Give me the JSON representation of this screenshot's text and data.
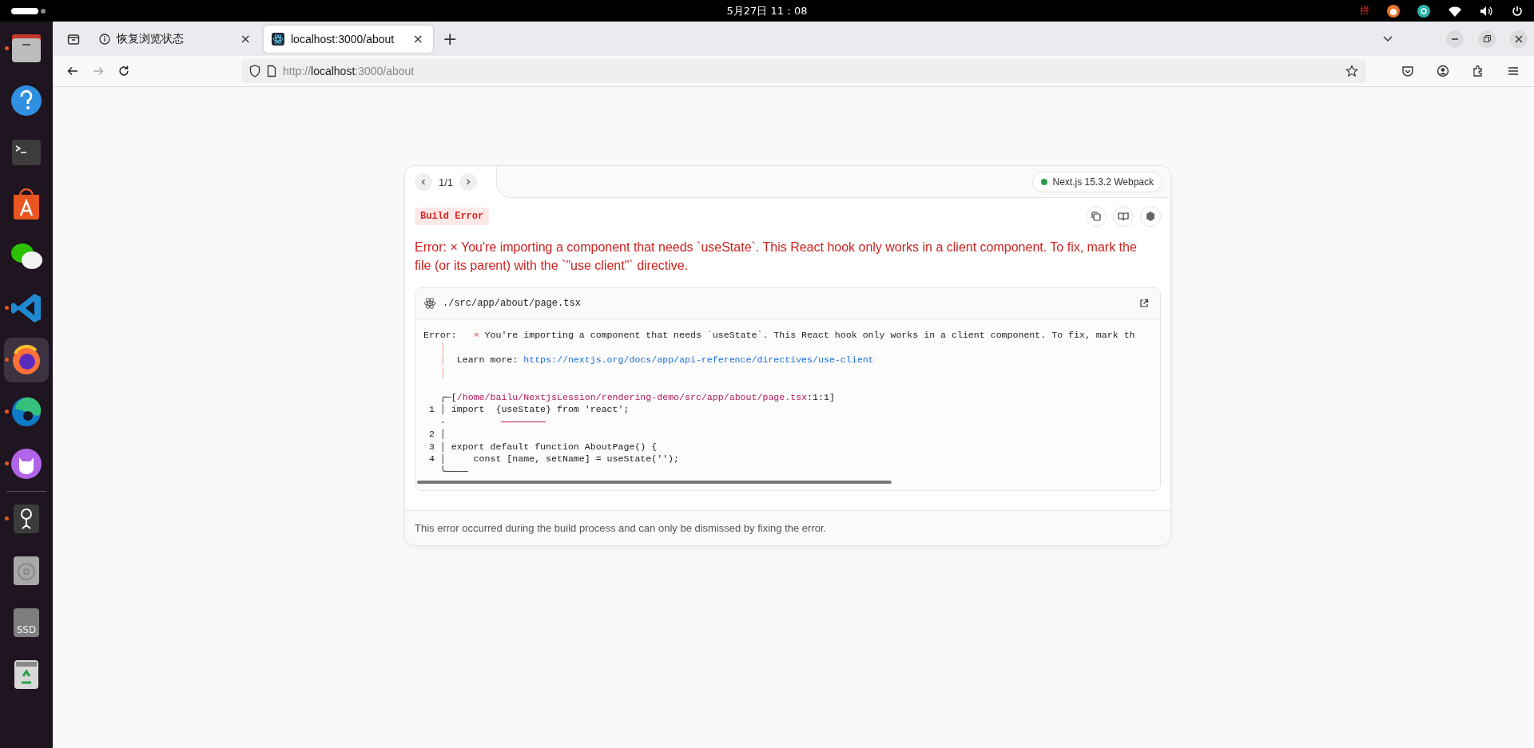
{
  "top_bar": {
    "clock": "5月27日  11：08",
    "input_method": "拼"
  },
  "dock": [
    {
      "kind": "files",
      "running": true,
      "selected": false
    },
    {
      "kind": "help",
      "running": false,
      "selected": false
    },
    {
      "kind": "terminal",
      "running": false,
      "selected": false
    },
    {
      "kind": "store",
      "running": false,
      "selected": false
    },
    {
      "kind": "chat",
      "running": false,
      "selected": false
    },
    {
      "kind": "code",
      "running": true,
      "selected": false
    },
    {
      "kind": "firefox",
      "running": true,
      "selected": true
    },
    {
      "kind": "edge",
      "running": true,
      "selected": false
    },
    {
      "kind": "cat",
      "running": true,
      "selected": false
    },
    {
      "kind": "separator"
    },
    {
      "kind": "webcam",
      "running": true,
      "selected": false
    },
    {
      "kind": "disc",
      "running": false,
      "selected": false
    },
    {
      "kind": "ssd",
      "label": "SSD",
      "running": false,
      "selected": false
    },
    {
      "kind": "trash",
      "running": false,
      "selected": false
    }
  ],
  "tabs": [
    {
      "kind": "notice",
      "label": "恢复浏览状态",
      "close": "×",
      "selected": false
    },
    {
      "kind": "site",
      "label": "localhost:3000/about",
      "close": "×",
      "selected": true
    }
  ],
  "new_tab": "+",
  "address_bar": {
    "scheme": "http://",
    "host": "localhost",
    "rest": ":3000/about"
  },
  "nav": {
    "back_disabled": false,
    "forward_disabled": true
  },
  "error_overlay": {
    "pager": "1/1",
    "prev_disabled": false,
    "next_disabled": false,
    "badge": {
      "label": "Next.js 15.3.2 Webpack",
      "color": "#2a9d4a"
    },
    "label": "Build Error",
    "message": "Error:  × You're importing a component that needs `useState`. This React hook only works in a client component. To fix, mark the file (or its parent) with the `\"use client\"` directive.",
    "file": "./src/app/about/page.tsx",
    "code_lines": [
      {
        "kind": "message",
        "segments": [
          {
            "kind": "plain",
            "text": "Error:   "
          },
          {
            "kind": "error",
            "text": "×"
          },
          {
            "kind": "plain",
            "text": " You're importing a component that needs `useState`. This React hook only works in a client component. To fix, mark th"
          }
        ]
      },
      {
        "kind": "note",
        "segments": [
          {
            "kind": "pipe",
            "text": "│"
          }
        ]
      },
      {
        "kind": "note",
        "segments": [
          {
            "kind": "pipe",
            "text": "│"
          },
          {
            "kind": "plain",
            "text": "  Learn more: "
          },
          {
            "kind": "link",
            "text": "https://nextjs.org/docs/app/api-reference/directives/use-client"
          }
        ]
      },
      {
        "kind": "note",
        "segments": [
          {
            "kind": "pipe",
            "text": "│"
          }
        ]
      },
      {
        "kind": "frame",
        "segments": [
          {
            "kind": "plain",
            "text": "   ╭─["
          },
          {
            "kind": "path",
            "text": "/home/bailu/NextjsLession/rendering-demo/src/app/about/page.tsx"
          },
          {
            "kind": "plain",
            "text": ":1:1]"
          }
        ]
      },
      {
        "kind": "source",
        "segments": [
          {
            "kind": "plain",
            "text": " 1 │ import  {useState} from 'react';"
          }
        ]
      },
      {
        "kind": "source",
        "segments": [
          {
            "kind": "plain",
            "text": "   ·"
          },
          {
            "kind": "underline"
          }
        ]
      },
      {
        "kind": "source",
        "segments": [
          {
            "kind": "plain",
            "text": " 2 │"
          }
        ]
      },
      {
        "kind": "source",
        "segments": [
          {
            "kind": "plain",
            "text": " 3 │ export default function AboutPage() {"
          }
        ]
      },
      {
        "kind": "source",
        "segments": [
          {
            "kind": "plain",
            "text": " 4 │     const [name, setName] = useState('');"
          }
        ]
      },
      {
        "kind": "source",
        "segments": [
          {
            "kind": "plain",
            "text": "   ╰────"
          }
        ]
      }
    ],
    "footer": "This error occurred during the build process and can only be dismissed by fixing the error."
  }
}
